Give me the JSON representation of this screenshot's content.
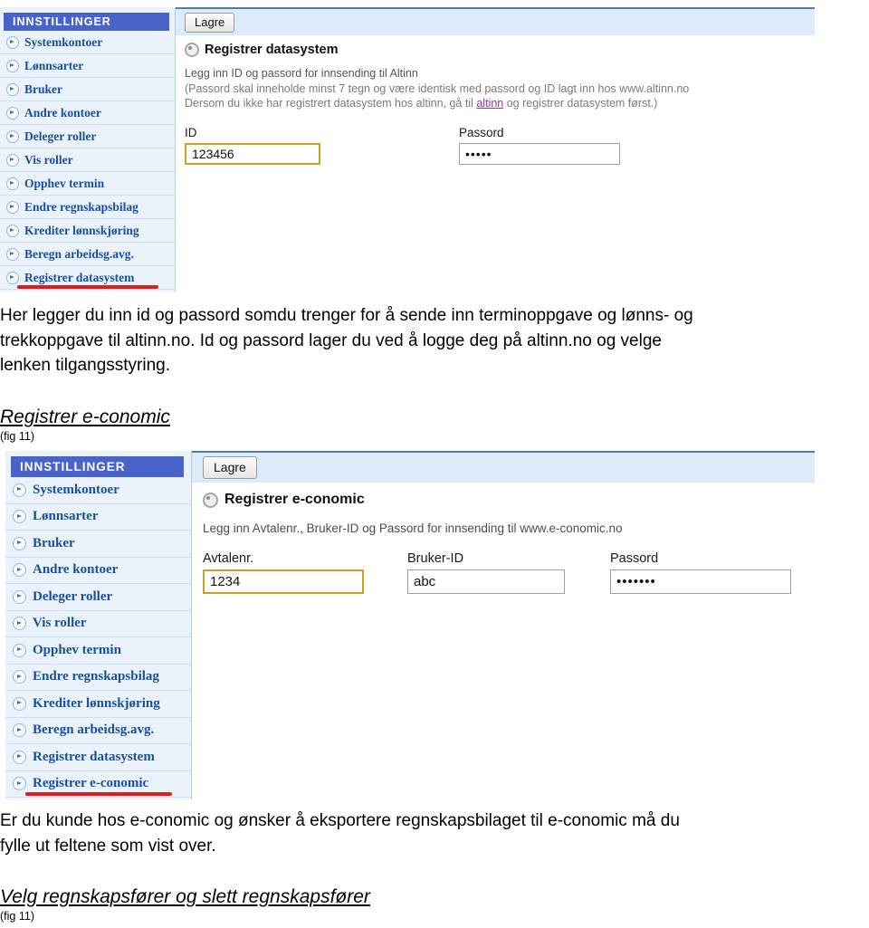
{
  "figure1": {
    "sidebar": {
      "header": "INNSTILLINGER",
      "items": [
        {
          "label": "Systemkontoer",
          "highlighted": false
        },
        {
          "label": "Lønnsarter",
          "highlighted": false
        },
        {
          "label": "Bruker",
          "highlighted": false
        },
        {
          "label": "Andre kontoer",
          "highlighted": false
        },
        {
          "label": "Deleger roller",
          "highlighted": false
        },
        {
          "label": "Vis roller",
          "highlighted": false
        },
        {
          "label": "Opphev termin",
          "highlighted": false
        },
        {
          "label": "Endre regnskapsbilag",
          "highlighted": false
        },
        {
          "label": "Krediter lønnskjøring",
          "highlighted": false
        },
        {
          "label": "Beregn arbeidsg.avg.",
          "highlighted": false
        },
        {
          "label": "Registrer datasystem",
          "highlighted": true
        }
      ]
    },
    "toolbar": {
      "save_label": "Lagre"
    },
    "section_title": "Registrer datasystem",
    "help": {
      "line1": "Legg inn ID og passord for innsending til Altinn",
      "line2": "(Passord skal inneholde minst 7 tegn og være identisk med passord og ID lagt inn hos www.altinn.no",
      "line3_before": "Dersom du ikke har registrert datasystem hos altinn, gå til ",
      "line3_link": "altinn",
      "line3_after": " og registrer datasystem først.)"
    },
    "fields": [
      {
        "label": "ID",
        "value": "123456",
        "focused": true
      },
      {
        "label": "Passord",
        "value": "•••••",
        "focused": false
      }
    ]
  },
  "prose1": {
    "line1": "Her legger du inn id og passord somdu trenger for å sende inn terminoppgave og lønns- og",
    "line2": "trekkoppgave til altinn.no. Id og passord lager du ved å logge deg på altinn.no og velge",
    "line3": "lenken tilgangsstyring."
  },
  "heading1": "Registrer e-conomic",
  "caption1": "(fig 11)",
  "figure2": {
    "sidebar": {
      "header": "INNSTILLINGER",
      "items": [
        {
          "label": "Systemkontoer",
          "highlighted": false
        },
        {
          "label": "Lønnsarter",
          "highlighted": false
        },
        {
          "label": "Bruker",
          "highlighted": false
        },
        {
          "label": "Andre kontoer",
          "highlighted": false
        },
        {
          "label": "Deleger roller",
          "highlighted": false
        },
        {
          "label": "Vis roller",
          "highlighted": false
        },
        {
          "label": "Opphev termin",
          "highlighted": false
        },
        {
          "label": "Endre regnskapsbilag",
          "highlighted": false
        },
        {
          "label": "Krediter lønnskjøring",
          "highlighted": false
        },
        {
          "label": "Beregn arbeidsg.avg.",
          "highlighted": false
        },
        {
          "label": "Registrer datasystem",
          "highlighted": false
        },
        {
          "label": "Registrer e-conomic",
          "highlighted": true
        }
      ]
    },
    "toolbar": {
      "save_label": "Lagre"
    },
    "section_title": "Registrer e-conomic",
    "help": {
      "line1": "Legg inn Avtalenr., Bruker-ID og Passord for innsending til www.e-conomic.no"
    },
    "fields": [
      {
        "label": "Avtalenr.",
        "value": "1234",
        "focused": true
      },
      {
        "label": "Bruker-ID",
        "value": "abc",
        "focused": false
      },
      {
        "label": "Passord",
        "value": "•••••••",
        "focused": false
      }
    ]
  },
  "prose2": {
    "line1": "Er du kunde hos e-conomic og ønsker å eksportere regnskapsbilaget til e-conomic må du",
    "line2": "fylle ut feltene som vist over."
  },
  "heading2": "Velg regnskapsfører og slett regnskapsfører",
  "caption2": "(fig 11)",
  "colors": {
    "sidebar_header_bg": "#4a63c8",
    "sidebar_bg": "#eaf3fc",
    "sidebar_link": "#1a4fa0",
    "toolbar_bg": "#dceaf9",
    "highlight_underline": "#e01b1b",
    "focus_border": "#c9a227",
    "visited_link": "#993399"
  }
}
